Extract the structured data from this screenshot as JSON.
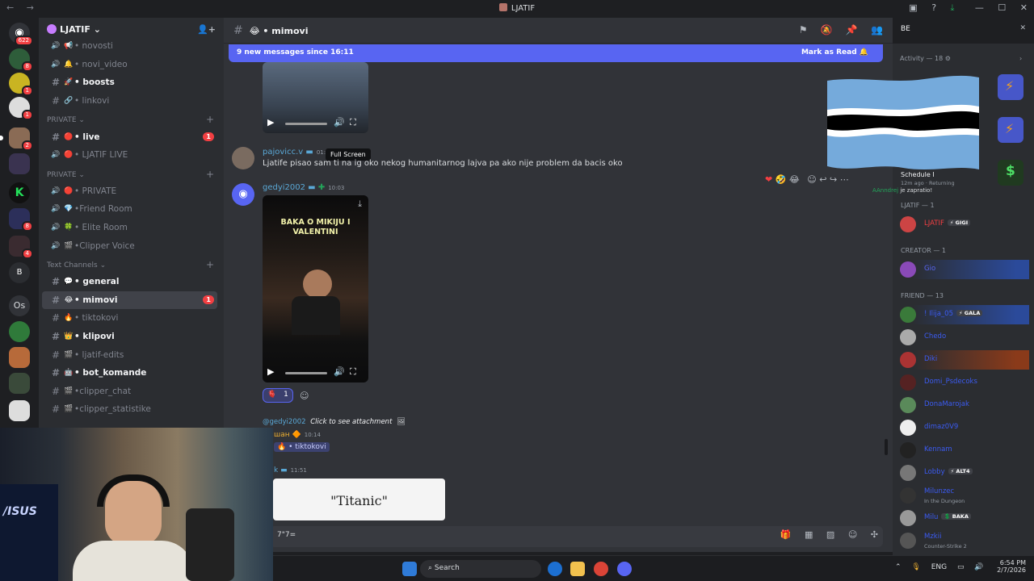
{
  "window": {
    "title": "LJATIF",
    "nav_back": "←",
    "nav_fwd": "→"
  },
  "servers": {
    "home_badge": "622",
    "badges": [
      "8",
      "1",
      "1",
      "2",
      "8",
      "4"
    ],
    "os_label": "Os"
  },
  "guild": {
    "name": "LJATIF"
  },
  "channels_top": [
    {
      "name": "• novosti",
      "emoji": "📢",
      "type": "speaker"
    },
    {
      "name": "• novi_video",
      "emoji": "🔔",
      "type": "speaker"
    },
    {
      "name": "• boosts",
      "emoji": "🚀",
      "type": "hash",
      "bright": true
    },
    {
      "name": "• linkovi",
      "emoji": "🔗",
      "type": "hash"
    }
  ],
  "private1": {
    "label": "PRIVATE"
  },
  "private1_channels": [
    {
      "name": "• live",
      "emoji": "🔴",
      "type": "hash",
      "bright": true,
      "badge": "1"
    },
    {
      "name": "• LJATIF LIVE",
      "emoji": "🔴",
      "type": "speaker"
    }
  ],
  "private2": {
    "label": "PRIVATE"
  },
  "private2_channels": [
    {
      "name": "• PRIVATE",
      "emoji": "🔴",
      "type": "speaker"
    },
    {
      "name": "•Friend Room",
      "emoji": "💎",
      "type": "speaker"
    },
    {
      "name": "• Elite Room",
      "emoji": "🍀",
      "type": "speaker"
    },
    {
      "name": "•Clipper Voice",
      "emoji": "🎬",
      "type": "speaker"
    }
  ],
  "text_channels": {
    "label": "Text Channels"
  },
  "text_channels_list": [
    {
      "name": "• general",
      "emoji": "💬",
      "type": "hash",
      "bright": true
    },
    {
      "name": "• mimovi",
      "emoji": "😂",
      "type": "hash",
      "bright": true,
      "active": true,
      "badge": "1"
    },
    {
      "name": "• tiktokovi",
      "emoji": "🔥",
      "type": "hash"
    },
    {
      "name": "• klipovi",
      "emoji": "👑",
      "type": "hash",
      "bright": true
    },
    {
      "name": "• ljatif-edits",
      "emoji": "🎬",
      "type": "hash"
    },
    {
      "name": "• bot_komande",
      "emoji": "🤖",
      "type": "hash",
      "bright": true
    },
    {
      "name": "•clipper_chat",
      "emoji": "🎬",
      "type": "hash"
    },
    {
      "name": "•clipper_statistike",
      "emoji": "🎬",
      "type": "hash"
    }
  ],
  "chat": {
    "channel": "• mimovi",
    "new_messages": "9 new messages since 16:11",
    "mark_as_read": "Mark as Read",
    "msg1": {
      "user": "pajovicc.v",
      "time": "01:5",
      "text": "Ljatife pisao sam ti na ig oko nekog humanitarnog lajva pa ako nije problem da bacis oko"
    },
    "tooltip": "Full Screen",
    "msg2": {
      "user": "gedyi2002",
      "time": "10:03",
      "video_caption": "BAKA O MIKIJU I VALENTINI",
      "reaction_count": "1"
    },
    "reply": {
      "ref_user": "@gedyi2002",
      "ref_text": "Click to see attachment",
      "user": "шан",
      "time": "10:14",
      "channel_link": "• tiktokovi"
    },
    "msg3": {
      "user": "k",
      "time": "11:51",
      "image_text": "\"Titanic\""
    },
    "composer_value": "7\"7="
  },
  "search": {
    "value": "BE"
  },
  "right": {
    "activity": "Activity — 18",
    "schedule": "Schedule I",
    "schedule_sub": "12m ago",
    "returning": "Returning",
    "left_notice_user": "AAnndrej",
    "left_notice_text": "je zapratio!",
    "groups": [
      {
        "label": "LJATIF — 1"
      },
      {
        "label": "CREATOR — 1"
      },
      {
        "label": "FRIEND — 13"
      }
    ],
    "members": [
      {
        "name": "LJATIF",
        "color": "#f23f42",
        "tag": "⚡ GIGI",
        "sub": ""
      },
      {
        "name": "Gio",
        "color": "#5865f2",
        "tag": "",
        "sub": ""
      },
      {
        "name": "! Ilija_05",
        "color": "#3b5bf2",
        "tag": "⚡ GALA",
        "sub": ""
      },
      {
        "name": "Chedo",
        "color": "#3b5bf2",
        "tag": "",
        "sub": ""
      },
      {
        "name": "Diki",
        "color": "#3b5bf2",
        "tag": "",
        "sub": ""
      },
      {
        "name": "Domi_Psdecoks",
        "color": "#3b5bf2",
        "tag": "",
        "sub": ""
      },
      {
        "name": "DonaMarojak",
        "color": "#3b5bf2",
        "tag": "",
        "sub": ""
      },
      {
        "name": "dimaz0V9",
        "color": "#3b5bf2",
        "tag": "",
        "sub": ""
      },
      {
        "name": "Kennam",
        "color": "#3b5bf2",
        "tag": "",
        "sub": ""
      },
      {
        "name": "Lobby",
        "color": "#3b5bf2",
        "tag": "⚡ ALT4",
        "sub": ""
      },
      {
        "name": "Milunzec",
        "color": "#3b5bf2",
        "tag": "",
        "sub": "In the Dungeon"
      },
      {
        "name": "Milu",
        "color": "#3b5bf2",
        "tag": "💲 BAKA",
        "sub": ""
      },
      {
        "name": "Mzkii",
        "color": "#3b5bf2",
        "tag": "",
        "sub": "Counter-Strike 2"
      }
    ]
  },
  "taskbar": {
    "search": "Search",
    "lang": "ENG",
    "time": "6:54 PM",
    "date": "2/7/2026"
  },
  "colors": {
    "accent": "#5865f2",
    "danger": "#f23f42",
    "bg": "#313338"
  }
}
